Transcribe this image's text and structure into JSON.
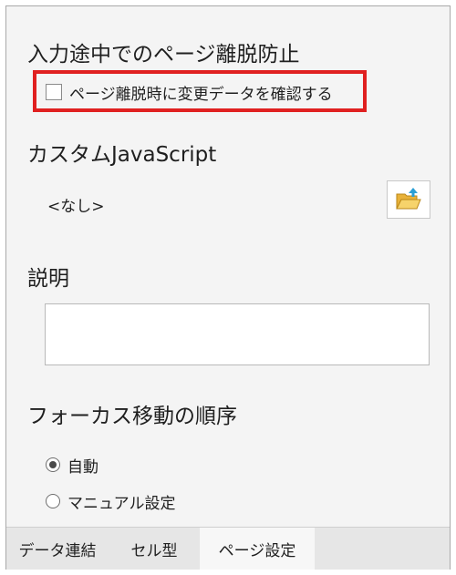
{
  "sections": {
    "leave_prevention": {
      "title": "入力途中でのページ離脱防止",
      "checkbox_label": "ページ離脱時に変更データを確認する",
      "checked": false
    },
    "custom_js": {
      "title": "カスタムJavaScript",
      "value": "<なし>",
      "button_icon": "folder-open-icon"
    },
    "description": {
      "title": "説明",
      "value": ""
    },
    "focus_order": {
      "title": "フォーカス移動の順序",
      "options": [
        {
          "label": "自動",
          "selected": true
        },
        {
          "label": "マニュアル設定",
          "selected": false
        }
      ]
    }
  },
  "tabs": [
    {
      "label": "データ連結",
      "active": false
    },
    {
      "label": "セル型",
      "active": false
    },
    {
      "label": "ページ設定",
      "active": true
    }
  ],
  "colors": {
    "highlight": "#e02020",
    "folder": "#f2c14e",
    "arrow": "#2a9fd6"
  }
}
